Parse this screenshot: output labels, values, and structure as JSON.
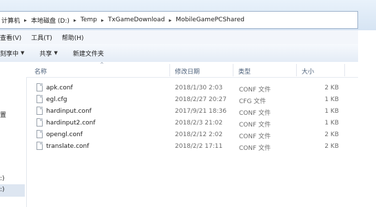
{
  "address": {
    "crumbs": [
      "计算机",
      "本地磁盘 (D:)",
      "Temp",
      "TxGameDownload",
      "MobileGamePCShared"
    ]
  },
  "menu": {
    "items": [
      "查看(V)",
      "工具(T)",
      "帮助(H)"
    ]
  },
  "command_bar": {
    "share_with": "刻享中",
    "share": "共享",
    "new_folder": "新建文件夹"
  },
  "nav_pane": {
    "label_a": "置",
    "label_b": ":)",
    "label_c": ":)"
  },
  "columns": {
    "name": "名称",
    "date": "修改日期",
    "type": "类型",
    "size": "大小"
  },
  "files": [
    {
      "name": "apk.conf",
      "date": "2018/1/30 2:03",
      "type": "CONF 文件",
      "size": "2 KB"
    },
    {
      "name": "egl.cfg",
      "date": "2018/2/27 20:27",
      "type": "CFG 文件",
      "size": "1 KB"
    },
    {
      "name": "hardinput.conf",
      "date": "2017/9/21 18:36",
      "type": "CONF 文件",
      "size": "1 KB"
    },
    {
      "name": "hardinput2.conf",
      "date": "2018/2/3 21:02",
      "type": "CONF 文件",
      "size": "1 KB"
    },
    {
      "name": "opengl.conf",
      "date": "2018/2/12 2:02",
      "type": "CONF 文件",
      "size": "2 KB"
    },
    {
      "name": "translate.conf",
      "date": "2018/2/2 17:11",
      "type": "CONF 文件",
      "size": "2 KB"
    }
  ]
}
